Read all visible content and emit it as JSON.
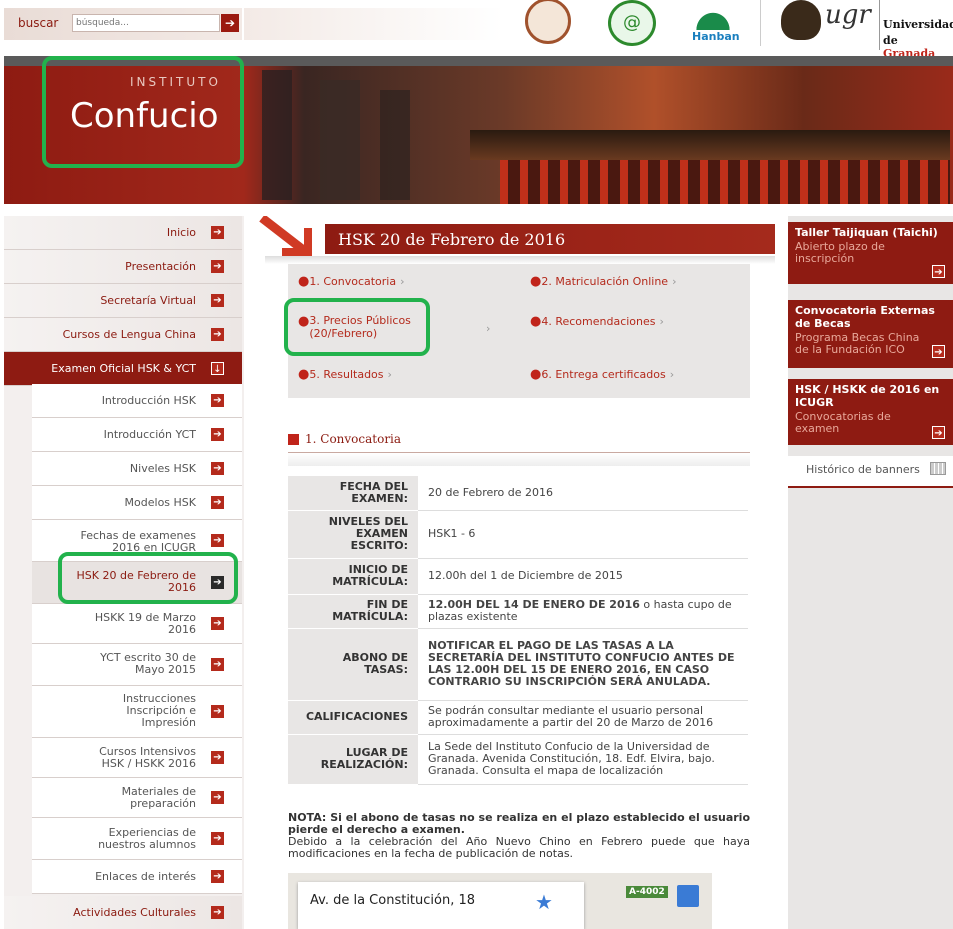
{
  "search": {
    "label": "buscar",
    "placeholder": "búsqueda..."
  },
  "logos": {
    "hanban": "Hanban",
    "ugr_word": "ugr",
    "ugr_line1": "Universidad",
    "ugr_line2_prefix": "de ",
    "ugr_line2_city": "Granada"
  },
  "header": {
    "inst": "INSTITUTO",
    "confucio": "Confucio"
  },
  "nav": [
    "Inicio",
    "Presentación",
    "Secretaría Virtual",
    "Cursos de Lengua China",
    "Examen Oficial HSK & YCT"
  ],
  "subnav": [
    "Introducción HSK",
    "Introducción YCT",
    "Niveles HSK",
    "Modelos HSK",
    "Fechas de examenes 2016 en ICUGR",
    "HSK 20 de Febrero de 2016",
    "HSKK 19 de Marzo 2016",
    "YCT escrito 30 de Mayo 2015",
    "Instrucciones Inscripción e Impresión",
    "Cursos Intensivos HSK / HSKK 2016",
    "Materiales de preparación",
    "Experiencias de nuestros alumnos",
    "Enlaces de interés"
  ],
  "nav_bottom": "Actividades Culturales",
  "page_title": "HSK 20 de Febrero de 2016",
  "sections": [
    "1. Convocatoria",
    "2. Matriculación Online",
    "3. Precios Públicos (20/Febrero)",
    "4. Recomendaciones",
    "5. Resultados",
    "6. Entrega certificados"
  ],
  "conv_title": "1. Convocatoria",
  "table": [
    {
      "k": "FECHA DEL EXAMEN:",
      "v": "20 de Febrero de 2016"
    },
    {
      "k": "NIVELES DEL EXAMEN ESCRITO:",
      "v": "HSK1 - 6"
    },
    {
      "k": "INICIO DE MATRÍCULA:",
      "v": "12.00h del 1 de Diciembre de 2015"
    },
    {
      "k": "FIN DE MATRÍCULA:",
      "v_bold": "12.00H DEL 14 DE ENERO DE 2016",
      "v": " o hasta cupo de plazas existente"
    },
    {
      "k": "ABONO DE TASAS:",
      "v_bold": "NOTIFICAR EL PAGO DE LAS TASAS A LA SECRETARÍA DEL INSTITUTO CONFUCIO ANTES DE LAS 12.00H DEL 15 DE ENERO 2016, EN CASO CONTRARIO SU INSCRIPCIÓN SERÁ ANULADA."
    },
    {
      "k": "CALIFICACIONES",
      "v": "Se podrán consultar mediante el usuario personal aproximadamente a partir del 20 de Marzo de 2016"
    },
    {
      "k": "LUGAR DE REALIZACIÓN:",
      "v": "La Sede del Instituto Confucio de la Universidad de Granada. Avenida Constitución, 18. Edf. Elvira, bajo. Granada. Consulta el mapa de localización"
    }
  ],
  "nota_bold": "NOTA: Si el abono de tasas no se realiza en el plazo establecido el usuario pierde el derecho a examen.",
  "nota_text": "Debido a la celebración del Año Nuevo Chino en Febrero puede que haya modificaciones en la fecha de publicación de notas.",
  "map": {
    "address": "Av. de la Constitución, 18",
    "road": "A-4002"
  },
  "banners": [
    {
      "title": "Taller Taijiquan (Taichi)",
      "desc": "Abierto plazo de inscripción"
    },
    {
      "title": "Convocatoria Externas de Becas",
      "desc": "Programa Becas China de la Fundación ICO"
    },
    {
      "title": "HSK / HSKK de 2016 en ICUGR",
      "desc": "Convocatorias de examen"
    }
  ],
  "hist_label": "Histórico de banners",
  "colors": {
    "brand": "#8e1b12",
    "accent": "#b42a1c",
    "highlight": "#22b24c"
  }
}
